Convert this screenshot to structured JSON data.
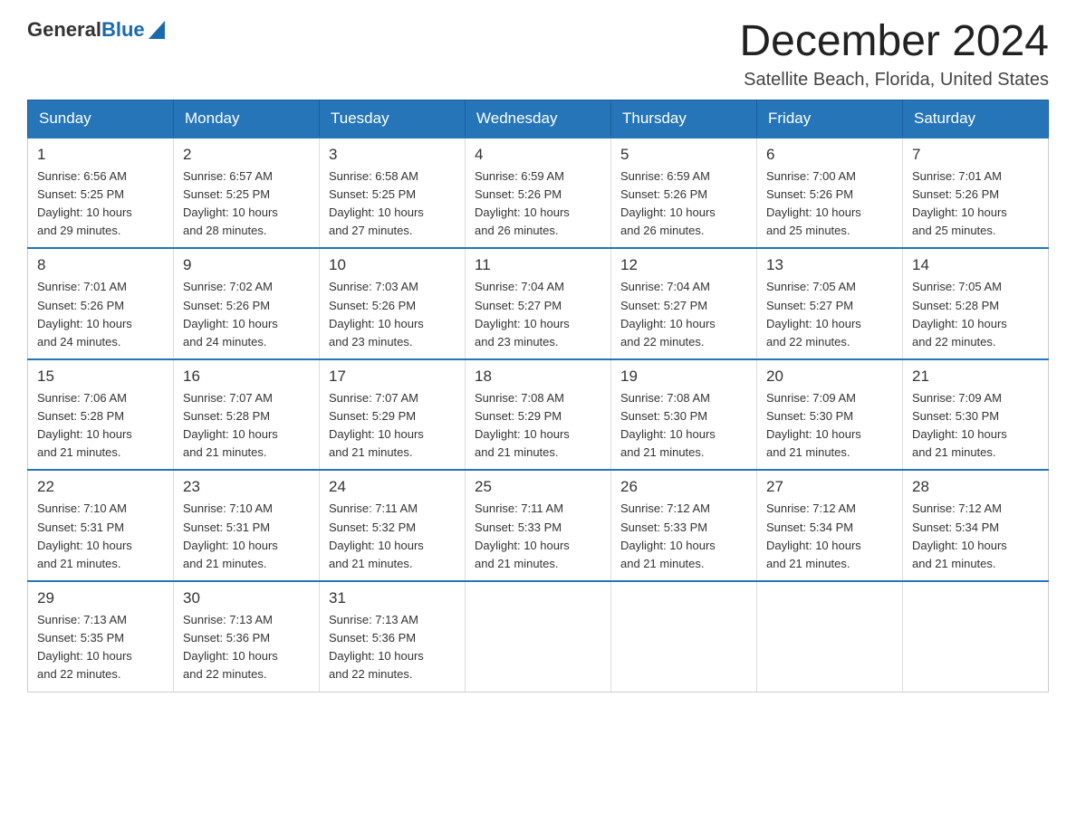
{
  "logo": {
    "text_general": "General",
    "text_blue": "Blue"
  },
  "title": "December 2024",
  "location": "Satellite Beach, Florida, United States",
  "weekdays": [
    "Sunday",
    "Monday",
    "Tuesday",
    "Wednesday",
    "Thursday",
    "Friday",
    "Saturday"
  ],
  "weeks": [
    [
      {
        "day": "1",
        "info": "Sunrise: 6:56 AM\nSunset: 5:25 PM\nDaylight: 10 hours\nand 29 minutes."
      },
      {
        "day": "2",
        "info": "Sunrise: 6:57 AM\nSunset: 5:25 PM\nDaylight: 10 hours\nand 28 minutes."
      },
      {
        "day": "3",
        "info": "Sunrise: 6:58 AM\nSunset: 5:25 PM\nDaylight: 10 hours\nand 27 minutes."
      },
      {
        "day": "4",
        "info": "Sunrise: 6:59 AM\nSunset: 5:26 PM\nDaylight: 10 hours\nand 26 minutes."
      },
      {
        "day": "5",
        "info": "Sunrise: 6:59 AM\nSunset: 5:26 PM\nDaylight: 10 hours\nand 26 minutes."
      },
      {
        "day": "6",
        "info": "Sunrise: 7:00 AM\nSunset: 5:26 PM\nDaylight: 10 hours\nand 25 minutes."
      },
      {
        "day": "7",
        "info": "Sunrise: 7:01 AM\nSunset: 5:26 PM\nDaylight: 10 hours\nand 25 minutes."
      }
    ],
    [
      {
        "day": "8",
        "info": "Sunrise: 7:01 AM\nSunset: 5:26 PM\nDaylight: 10 hours\nand 24 minutes."
      },
      {
        "day": "9",
        "info": "Sunrise: 7:02 AM\nSunset: 5:26 PM\nDaylight: 10 hours\nand 24 minutes."
      },
      {
        "day": "10",
        "info": "Sunrise: 7:03 AM\nSunset: 5:26 PM\nDaylight: 10 hours\nand 23 minutes."
      },
      {
        "day": "11",
        "info": "Sunrise: 7:04 AM\nSunset: 5:27 PM\nDaylight: 10 hours\nand 23 minutes."
      },
      {
        "day": "12",
        "info": "Sunrise: 7:04 AM\nSunset: 5:27 PM\nDaylight: 10 hours\nand 22 minutes."
      },
      {
        "day": "13",
        "info": "Sunrise: 7:05 AM\nSunset: 5:27 PM\nDaylight: 10 hours\nand 22 minutes."
      },
      {
        "day": "14",
        "info": "Sunrise: 7:05 AM\nSunset: 5:28 PM\nDaylight: 10 hours\nand 22 minutes."
      }
    ],
    [
      {
        "day": "15",
        "info": "Sunrise: 7:06 AM\nSunset: 5:28 PM\nDaylight: 10 hours\nand 21 minutes."
      },
      {
        "day": "16",
        "info": "Sunrise: 7:07 AM\nSunset: 5:28 PM\nDaylight: 10 hours\nand 21 minutes."
      },
      {
        "day": "17",
        "info": "Sunrise: 7:07 AM\nSunset: 5:29 PM\nDaylight: 10 hours\nand 21 minutes."
      },
      {
        "day": "18",
        "info": "Sunrise: 7:08 AM\nSunset: 5:29 PM\nDaylight: 10 hours\nand 21 minutes."
      },
      {
        "day": "19",
        "info": "Sunrise: 7:08 AM\nSunset: 5:30 PM\nDaylight: 10 hours\nand 21 minutes."
      },
      {
        "day": "20",
        "info": "Sunrise: 7:09 AM\nSunset: 5:30 PM\nDaylight: 10 hours\nand 21 minutes."
      },
      {
        "day": "21",
        "info": "Sunrise: 7:09 AM\nSunset: 5:30 PM\nDaylight: 10 hours\nand 21 minutes."
      }
    ],
    [
      {
        "day": "22",
        "info": "Sunrise: 7:10 AM\nSunset: 5:31 PM\nDaylight: 10 hours\nand 21 minutes."
      },
      {
        "day": "23",
        "info": "Sunrise: 7:10 AM\nSunset: 5:31 PM\nDaylight: 10 hours\nand 21 minutes."
      },
      {
        "day": "24",
        "info": "Sunrise: 7:11 AM\nSunset: 5:32 PM\nDaylight: 10 hours\nand 21 minutes."
      },
      {
        "day": "25",
        "info": "Sunrise: 7:11 AM\nSunset: 5:33 PM\nDaylight: 10 hours\nand 21 minutes."
      },
      {
        "day": "26",
        "info": "Sunrise: 7:12 AM\nSunset: 5:33 PM\nDaylight: 10 hours\nand 21 minutes."
      },
      {
        "day": "27",
        "info": "Sunrise: 7:12 AM\nSunset: 5:34 PM\nDaylight: 10 hours\nand 21 minutes."
      },
      {
        "day": "28",
        "info": "Sunrise: 7:12 AM\nSunset: 5:34 PM\nDaylight: 10 hours\nand 21 minutes."
      }
    ],
    [
      {
        "day": "29",
        "info": "Sunrise: 7:13 AM\nSunset: 5:35 PM\nDaylight: 10 hours\nand 22 minutes."
      },
      {
        "day": "30",
        "info": "Sunrise: 7:13 AM\nSunset: 5:36 PM\nDaylight: 10 hours\nand 22 minutes."
      },
      {
        "day": "31",
        "info": "Sunrise: 7:13 AM\nSunset: 5:36 PM\nDaylight: 10 hours\nand 22 minutes."
      },
      {
        "day": "",
        "info": ""
      },
      {
        "day": "",
        "info": ""
      },
      {
        "day": "",
        "info": ""
      },
      {
        "day": "",
        "info": ""
      }
    ]
  ]
}
